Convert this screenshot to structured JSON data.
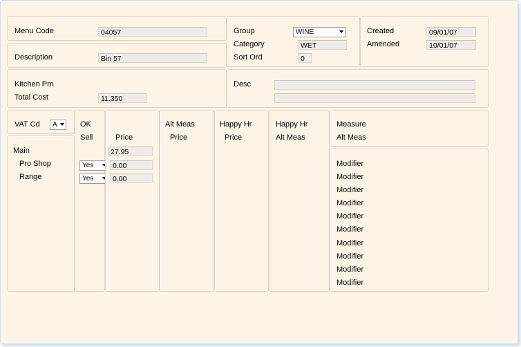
{
  "header": {
    "menu_code_label": "Menu Code",
    "menu_code_value": "04057",
    "description_label": "Description",
    "description_value": "Bin 57",
    "group_label": "Group",
    "group_value": "WINE",
    "category_label": "Category",
    "category_value": "WET",
    "sort_ord_label": "Sort Ord",
    "sort_ord_value": "0",
    "created_label": "Created",
    "created_value": "09/01/07",
    "amended_label": "Amended",
    "amended_value": "10/01/07"
  },
  "kitchen": {
    "kitchen_prn_label": "Kitchen Prn",
    "total_cost_label": "Total Cost",
    "total_cost_value": "11.350",
    "desc_label": "Desc",
    "desc_line1": "",
    "desc_line2": ""
  },
  "grid": {
    "vat_cd_label": "VAT Cd",
    "vat_cd_value": "A",
    "ok_label": "OK",
    "sell_label": "Sell",
    "price_label": "Price",
    "alt_meas_label": "Alt Meas",
    "alt_price_label": "Price",
    "happy_hr_label": "Happy Hr",
    "happy_price_label": "Price",
    "happy_hr2_label": "Happy Hr",
    "happy_alt_meas_label": "Alt Meas",
    "measure_label": "Measure",
    "measure_alt_meas_label": "Alt Meas",
    "rows": [
      {
        "name": "Main",
        "sell": "",
        "price": "27.95"
      },
      {
        "name": "Pro Shop",
        "sell": "Yes",
        "price": "0.00"
      },
      {
        "name": "Range",
        "sell": "Yes",
        "price": "0.00"
      }
    ],
    "modifiers": [
      "Modifier",
      "Modifier",
      "Modifier",
      "Modifier",
      "Modifier",
      "Modifier",
      "Modifier",
      "Modifier",
      "Modifier",
      "Modifier"
    ]
  }
}
